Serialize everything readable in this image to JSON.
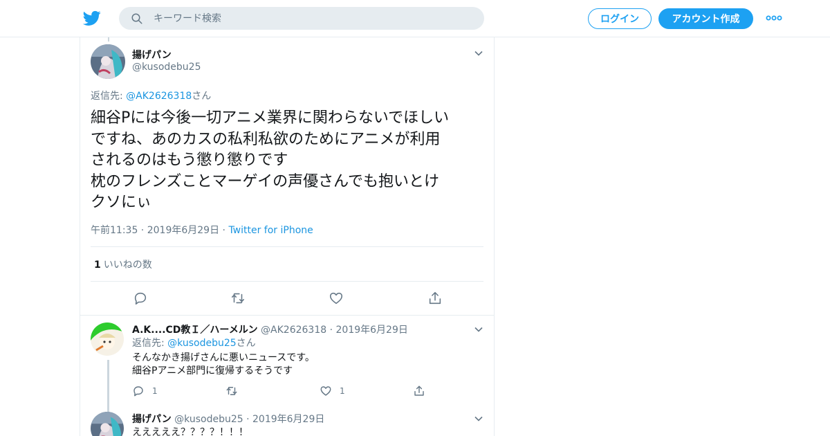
{
  "header": {
    "search_placeholder": "キーワード検索",
    "login_label": "ログイン",
    "signup_label": "アカウント作成",
    "accent_color": "#1da1f2"
  },
  "main_tweet": {
    "name": "揚げパン",
    "handle": "@kusodebu25",
    "reply_prefix": "返信先: ",
    "reply_to": "@AK2626318",
    "reply_suffix": "さん",
    "text": "細谷Pには今後一切アニメ業界に関わらないでほしい\nですね、あのカスの私利私欲のためにアニメが利用\nされるのはもう懲り懲りです\n枕のフレンズことマーゲイの声優さんでも抱いとけ\nクソにぃ",
    "time": "午前11:35",
    "date": "2019年6月29日",
    "source": "Twitter for iPhone",
    "likes_count": "1",
    "likes_label": "いいねの数"
  },
  "replies": [
    {
      "name": "A.K....CD教Ｉ／ハーメルン",
      "handle": "@AK2626318",
      "date": "2019年6月29日",
      "reply_prefix": "返信先: ",
      "reply_to": "@kusodebu25",
      "reply_suffix": "さん",
      "line1": "そんなかき揚げさんに悪いニュースです。",
      "line2": "細谷Pアニメ部門に復帰するそうです",
      "reply_count": "1",
      "like_count": "1"
    },
    {
      "name": "揚げパン",
      "handle": "@kusodebu25",
      "date": "2019年6月29日",
      "line1": "えええええ？？？？！！！"
    }
  ],
  "icons": [
    "twitter-bird-icon",
    "search-icon",
    "more-icon",
    "chevron-down-icon",
    "reply-icon",
    "retweet-icon",
    "like-icon",
    "share-icon"
  ]
}
